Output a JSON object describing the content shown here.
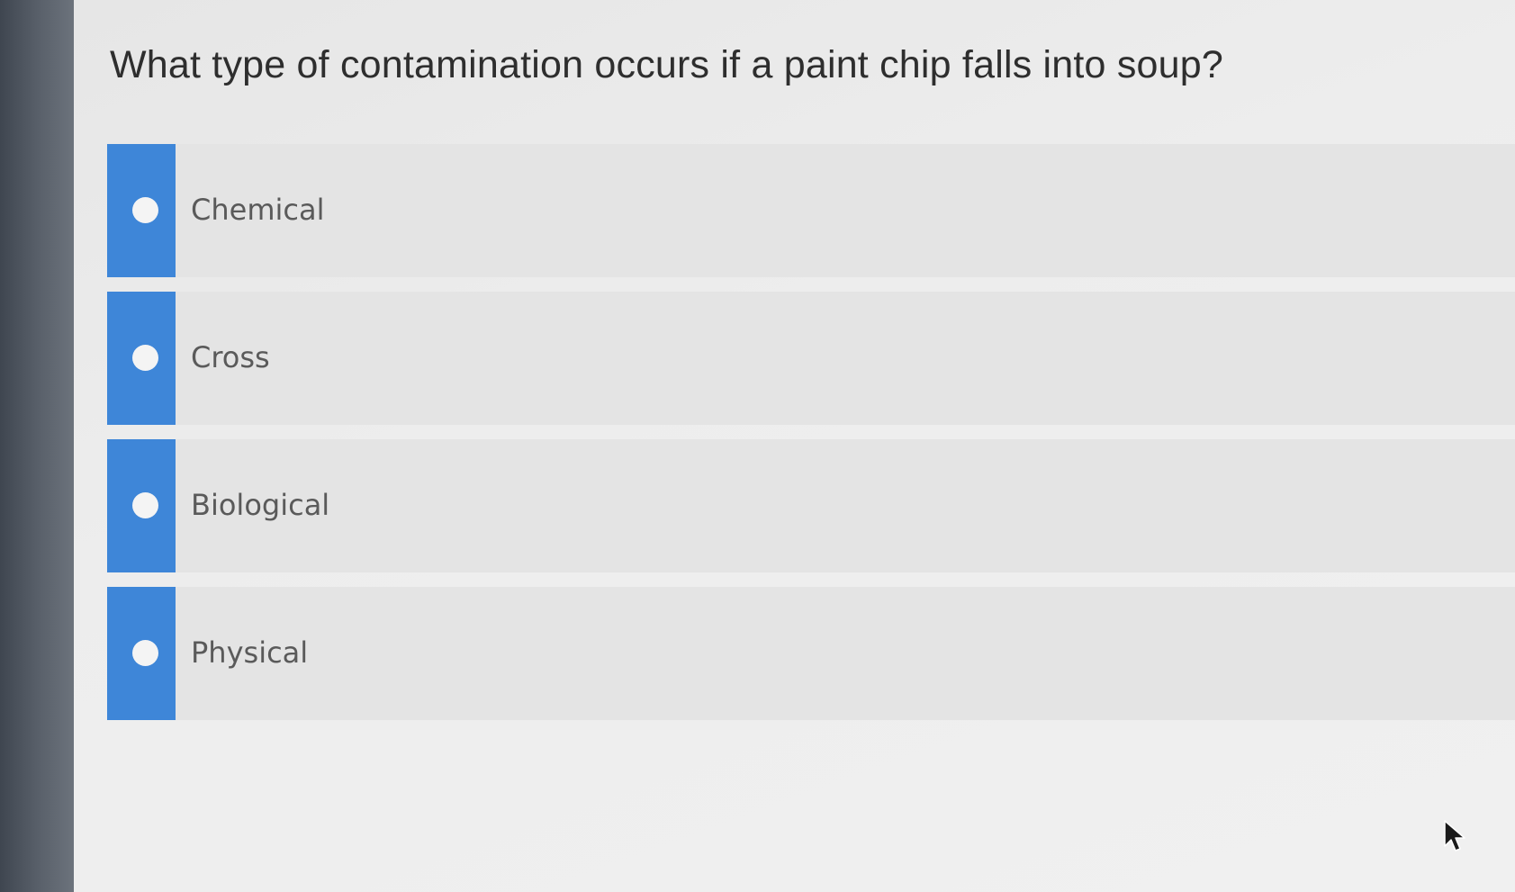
{
  "question": {
    "text": "What type of contamination occurs if a paint chip falls into soup?"
  },
  "options": [
    {
      "label": "Chemical"
    },
    {
      "label": "Cross"
    },
    {
      "label": "Biological"
    },
    {
      "label": "Physical"
    }
  ],
  "colors": {
    "option_accent": "#3e86d8",
    "option_background": "#e4e4e4",
    "question_text": "#2e2e2e",
    "option_text": "#5a5a5a"
  },
  "icons": {
    "radio": "radio-empty-circle",
    "cursor": "mouse-pointer-arrow"
  }
}
